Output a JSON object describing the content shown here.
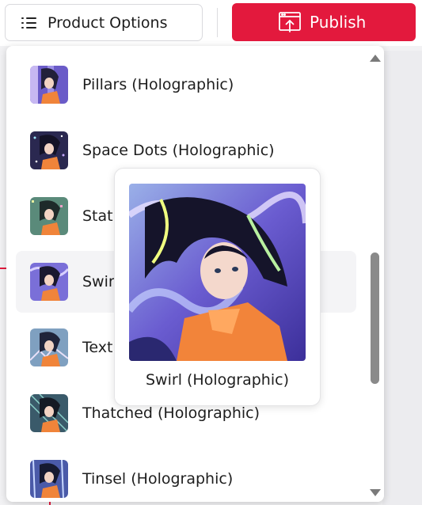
{
  "toolbar": {
    "options_label": "Product Options",
    "options_icon": "list-icon",
    "publish_label": "Publish",
    "publish_icon": "upload-window-icon",
    "publish_color": "#e3193d"
  },
  "dropdown": {
    "items": [
      {
        "label": "Pillars (Holographic)",
        "thumb": "pillars-artwork"
      },
      {
        "label": "Space Dots (Holographic)",
        "thumb": "space-dots-artwork"
      },
      {
        "label": "Stat",
        "thumb": "static-artwork"
      },
      {
        "label": "Swir",
        "thumb": "swirl-artwork",
        "active": true
      },
      {
        "label": "Text",
        "thumb": "texture-artwork"
      },
      {
        "label": "Thatched (Holographic)",
        "thumb": "thatched-artwork"
      },
      {
        "label": "Tinsel (Holographic)",
        "thumb": "tinsel-artwork"
      }
    ],
    "scroll_up_icon": "triangle-up-icon",
    "scroll_down_icon": "triangle-down-icon"
  },
  "preview": {
    "label": "Swirl (Holographic)",
    "image": "swirl-holographic-artwork"
  }
}
